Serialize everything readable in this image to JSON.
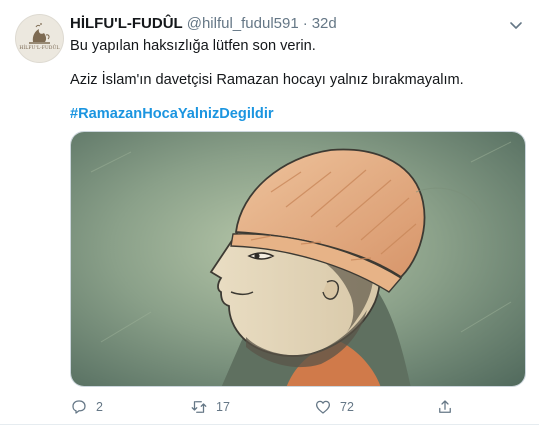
{
  "tweet": {
    "display_name": "HİLFU'L-FUDÛL",
    "handle": "@hilful_fudul591",
    "separator": "·",
    "time": "32d",
    "lines": [
      "Bu yapılan haksızlığa lütfen son verin.",
      "Aziz İslam'ın davetçisi Ramazan hocayı yalnız bırakmayalım."
    ],
    "hashtag": "#RamazanHocaYalnizDegildir",
    "avatar_text": "HİLFU'L-FUDÛL",
    "icons": {
      "more": "chevron-down-icon",
      "reply": "reply-icon",
      "retweet": "retweet-icon",
      "like": "heart-icon",
      "share": "share-icon"
    },
    "counts": {
      "replies": "2",
      "retweets": "17",
      "likes": "72"
    },
    "colors": {
      "link": "#1b95e0",
      "secondary_text": "#657786",
      "primary_text": "#14171a",
      "border": "#e6ecf0"
    }
  }
}
